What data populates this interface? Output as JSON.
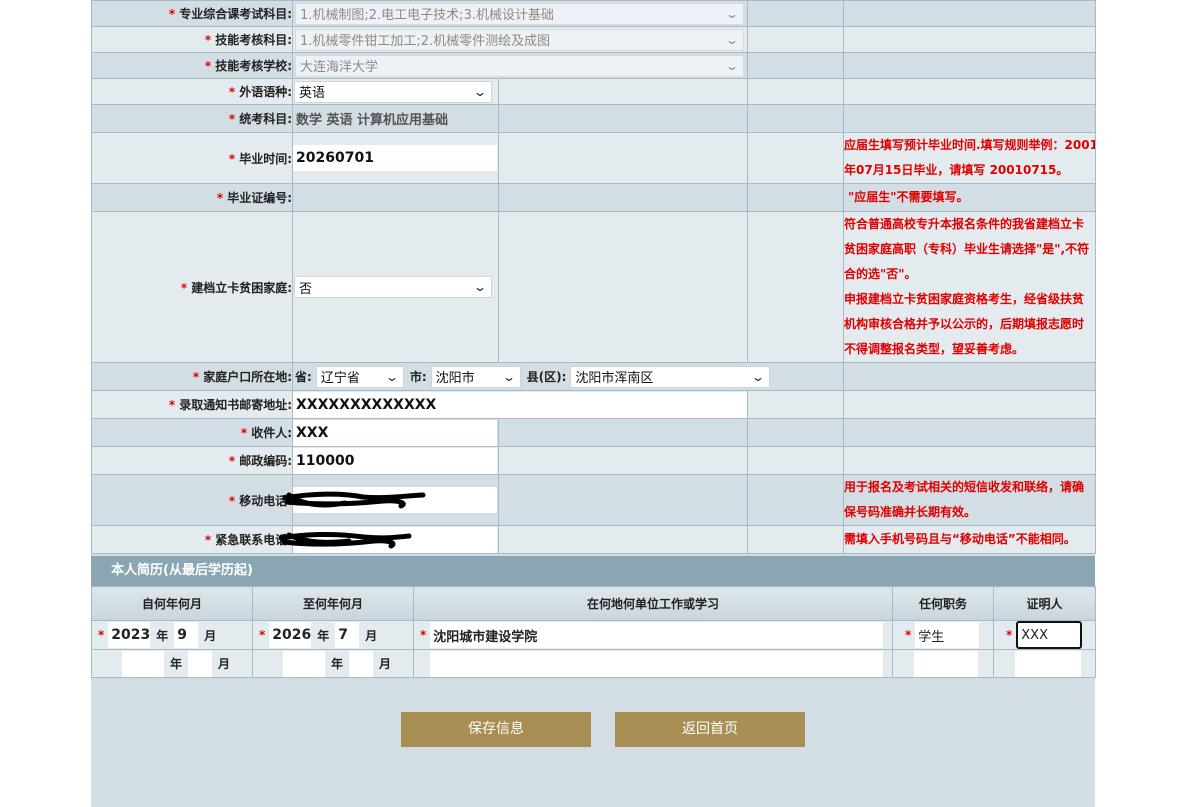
{
  "form": {
    "major_subjects": {
      "label": "专业综合课考试科目:",
      "value": "1.机械制图;2.电工电子技术;3.机械设计基础"
    },
    "skill_subjects": {
      "label": "技能考核科目:",
      "value": "1.机械零件钳工加工;2.机械零件测绘及成图"
    },
    "skill_school": {
      "label": "技能考核学校:",
      "value": "大连海洋大学"
    },
    "foreign_lang": {
      "label": "外语语种:",
      "value": "英语"
    },
    "unified_subjects": {
      "label": "统考科目:",
      "value": "数学 英语 计算机应用基础"
    },
    "grad_time": {
      "label": "毕业时间:",
      "value": "20260701",
      "note": [
        "应届生填写预计毕业时间.填写规则举例：2001",
        "年07月15日毕业，请填写 20010715。"
      ]
    },
    "diploma_no": {
      "label": "毕业证编号:",
      "value": "",
      "note": [
        "\"应届生\"不需要填写。"
      ]
    },
    "poverty": {
      "label": "建档立卡贫困家庭:",
      "value": "否",
      "note": [
        "符合普通高校专升本报名条件的我省建档立卡",
        "贫困家庭高职（专科）毕业生请选择\"是\",不符",
        "合的选\"否\"。",
        "申报建档立卡贫困家庭资格考生，经省级扶贫",
        "机构审核合格并予以公示的，后期填报志愿时",
        "不得调整报名类型，望妥善考虑。"
      ]
    },
    "hukou": {
      "label": "家庭户口所在地:",
      "province_label": "省:",
      "province": "辽宁省",
      "city_label": "市:",
      "city": "沈阳市",
      "county_label": "县(区):",
      "county": "沈阳市浑南区"
    },
    "mail_addr": {
      "label": "录取通知书邮寄地址:",
      "value": "XXXXXXXXXXXXX"
    },
    "recipient": {
      "label": "收件人:",
      "value": "XXX"
    },
    "postcode": {
      "label": "邮政编码:",
      "value": "110000"
    },
    "mobile": {
      "label": "移动电话:",
      "value": "",
      "note": [
        "用于报名及考试相关的短信收发和联络，请确",
        "保号码准确并长期有效。"
      ]
    },
    "emergency": {
      "label": "紧急联系电话:",
      "value": "",
      "note": [
        "需填入手机号码且与“移动电话”不能相同。"
      ]
    }
  },
  "resume": {
    "title": "本人简历(从最后学历起)",
    "headers": [
      "自何年何月",
      "至何年何月",
      "在何地何单位工作或学习",
      "任何职务",
      "证明人"
    ],
    "year_label": "年",
    "month_label": "月",
    "rows": [
      {
        "from_year": "2023",
        "from_month": "9",
        "to_year": "2026",
        "to_month": "7",
        "place": "沈阳城市建设学院",
        "position": "学生",
        "witness": "XXX"
      },
      {
        "from_year": "",
        "from_month": "",
        "to_year": "",
        "to_month": "",
        "place": "",
        "position": "",
        "witness": ""
      }
    ]
  },
  "buttons": {
    "save": "保存信息",
    "home": "返回首页"
  },
  "required_mark": "*",
  "colors": {
    "button": "#a78e52",
    "section_header": "#8aa6b3",
    "required": "#e00000"
  }
}
